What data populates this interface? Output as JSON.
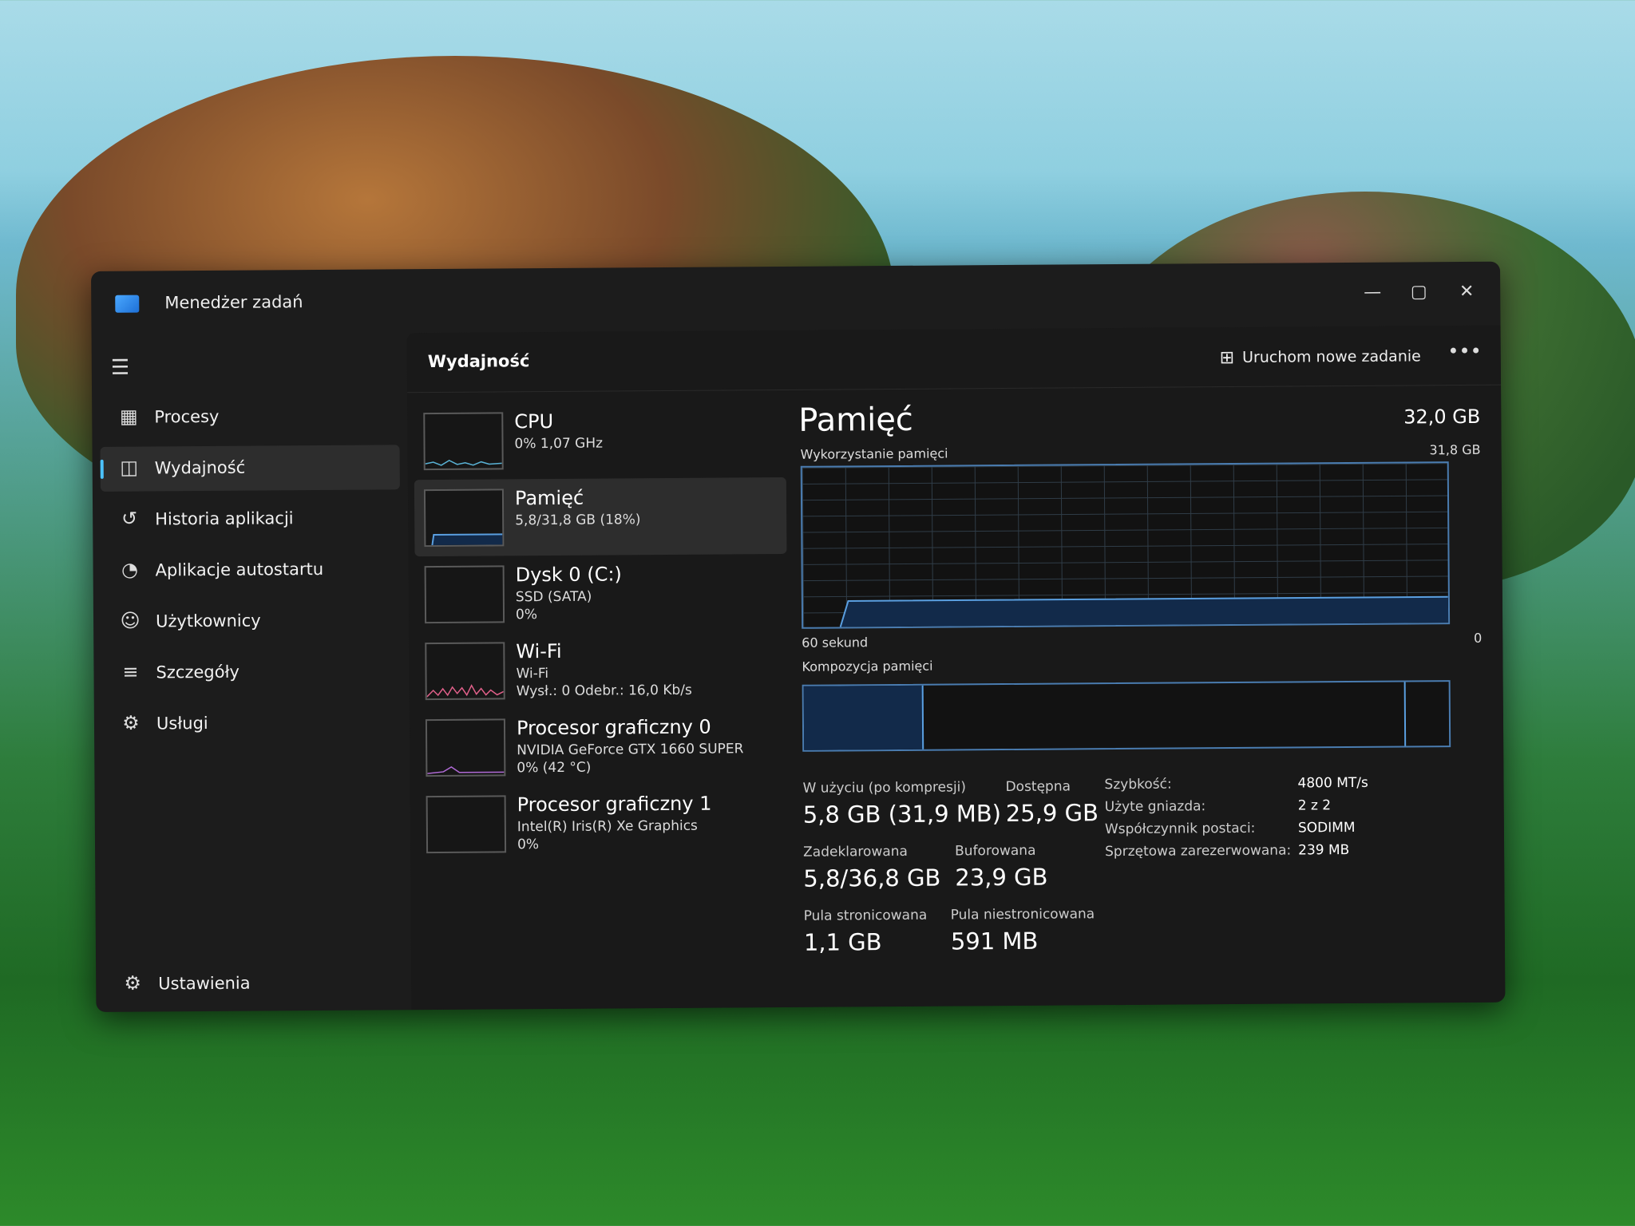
{
  "window": {
    "title": "Menedżer zadań"
  },
  "sidebar": {
    "items": [
      {
        "label": "Procesy",
        "icon": "processes-icon"
      },
      {
        "label": "Wydajność",
        "icon": "performance-icon"
      },
      {
        "label": "Historia aplikacji",
        "icon": "history-icon"
      },
      {
        "label": "Aplikacje autostartu",
        "icon": "startup-icon"
      },
      {
        "label": "Użytkownicy",
        "icon": "users-icon"
      },
      {
        "label": "Szczegóły",
        "icon": "details-icon"
      },
      {
        "label": "Usługi",
        "icon": "services-icon"
      }
    ],
    "settings": "Ustawienia"
  },
  "header": {
    "title": "Wydajność",
    "run_task": "Uruchom nowe zadanie"
  },
  "resources": [
    {
      "name": "CPU",
      "line2": "0% 1,07 GHz",
      "line3": ""
    },
    {
      "name": "Pamięć",
      "line2": "5,8/31,8 GB (18%)",
      "line3": ""
    },
    {
      "name": "Dysk 0 (C:)",
      "line2": "SSD (SATA)",
      "line3": "0%"
    },
    {
      "name": "Wi-Fi",
      "line2": "Wi-Fi",
      "line3": "Wysł.: 0 Odebr.: 16,0 Kb/s"
    },
    {
      "name": "Procesor graficzny 0",
      "line2": "NVIDIA GeForce GTX 1660 SUPER",
      "line3": "0% (42 °C)"
    },
    {
      "name": "Procesor graficzny 1",
      "line2": "Intel(R) Iris(R) Xe Graphics",
      "line3": "0%"
    }
  ],
  "detail": {
    "title": "Pamięć",
    "total": "32,0 GB",
    "usage_label": "Wykorzystanie pamięci",
    "usage_max": "31,8 GB",
    "time_label": "60 sekund",
    "time_zero": "0",
    "composition_label": "Kompozycja pamięci",
    "usage_fraction": 0.18,
    "stats": {
      "in_use_label": "W użyciu (po kompresji)",
      "in_use": "5,8 GB (31,9 MB)",
      "available_label": "Dostępna",
      "available": "25,9 GB",
      "committed_label": "Zadeklarowana",
      "committed": "5,8/36,8 GB",
      "cached_label": "Buforowana",
      "cached": "23,9 GB",
      "paged_label": "Pula stronicowana",
      "paged": "1,1 GB",
      "nonpaged_label": "Pula niestronicowana",
      "nonpaged": "591 MB"
    },
    "props": [
      {
        "k": "Szybkość:",
        "v": "4800 MT/s"
      },
      {
        "k": "Użyte gniazda:",
        "v": "2 z 2"
      },
      {
        "k": "Współczynnik postaci:",
        "v": "SODIMM"
      },
      {
        "k": "Sprzętowa zarezerwowana:",
        "v": "239 MB"
      }
    ]
  },
  "colors": {
    "accent": "#4cc2ff",
    "memory_line": "#5a9fe0",
    "memory_fill": "#122a4a"
  }
}
